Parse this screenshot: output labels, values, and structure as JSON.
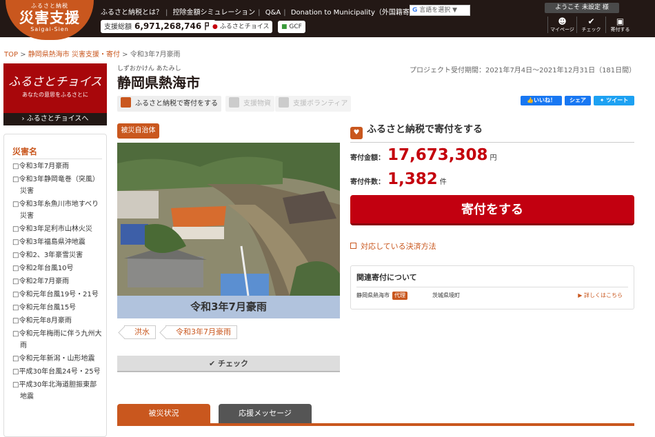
{
  "header": {
    "logo_top": "ふるさと納税",
    "logo_main": "災害支援",
    "logo_sub": "Saigai-Sien",
    "nav": [
      "ふるさと納税とは？",
      "控除金額シミュレーション",
      "Q&A",
      "Donation to Municipality（外国籍寄付受付）"
    ],
    "language_select": "言語を選択",
    "total_label": "支援総額",
    "total_value": "6,971,268,746 円",
    "furusato_choice_btn": "ふるさとチョイス",
    "gcf_btn": "GCF",
    "welcome": "ようこそ 未設定 様",
    "icons": [
      {
        "label": "マイページ",
        "icon": "user-icon"
      },
      {
        "label": "チェック",
        "icon": "check-icon"
      },
      {
        "label": "寄付する",
        "icon": "donate-icon"
      }
    ]
  },
  "breadcrumb": {
    "items": [
      "TOP",
      "静岡県熱海市 災害支援・寄付",
      "令和3年7月豪雨"
    ],
    "sep": ">"
  },
  "sidebar": {
    "banner_title": "ふるさとチョイス",
    "banner_tagline": "あなたの意思をふるさとに",
    "banner_link": "› ふるさとチョイスへ",
    "disaster_heading": "災害名",
    "disasters": [
      "令和3年7月豪雨",
      "令和3年静岡竜巻（突風）災害",
      "令和3年糸魚川市地すべり災害",
      "令和3年足利市山林火災",
      "令和3年福島県沖地震",
      "令和2、3年豪雪災害",
      "令和2年台風10号",
      "令和2年7月豪雨",
      "令和元年台風19号・21号",
      "令和元年台風15号",
      "令和元年8月豪雨",
      "令和元年梅雨に伴う九州大雨",
      "令和元年新潟・山形地震",
      "平成30年台風24号・25号",
      "平成30年北海道胆振東部地震"
    ]
  },
  "project": {
    "kana": "しずおかけん あたみし",
    "city": "静岡県熱海市",
    "period": "プロジェクト受付期間：2021年7月4日〜2021年12月31日（181日間）",
    "actions": [
      "ふるさと納税で寄付をする",
      "支援物資",
      "支援ボランティア"
    ],
    "social": [
      "いいね！",
      "シェア",
      "ツイート"
    ],
    "badge": "被災自治体",
    "photo_caption": "令和3年7月豪雨",
    "tags": [
      "洪水",
      "令和3年7月豪雨"
    ],
    "check_button": "チェック",
    "tabs": [
      "被災状況",
      "応援メッセージ"
    ]
  },
  "donation": {
    "heading": "ふるさと納税で寄付をする",
    "amount_label": "寄付金額：",
    "amount_value": "17,673,308",
    "amount_unit": "円",
    "count_label": "寄付件数：",
    "count_value": "1,382",
    "count_unit": "件",
    "donate_button": "寄付をする",
    "payment_link": "対応している決済方法",
    "related_heading": "関連寄付について",
    "related_city": "静岡県熱海市",
    "related_badge": "代理",
    "related_proxy": "茨城県境町",
    "related_more": "▶ 詳しくはこちら"
  },
  "colors": {
    "brand": "#c9571e",
    "donate_red": "#c20010",
    "header_bg": "#231815"
  }
}
